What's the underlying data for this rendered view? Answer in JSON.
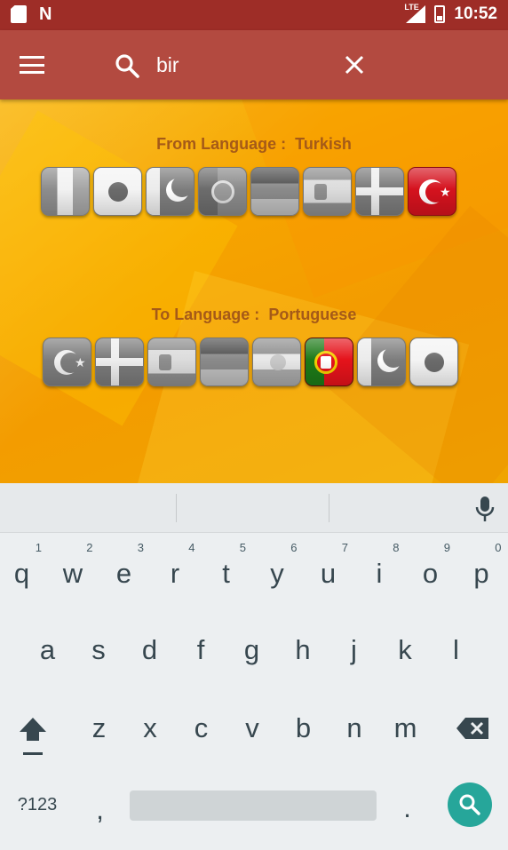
{
  "status_bar": {
    "time": "10:52",
    "network": "LTE"
  },
  "app_bar": {
    "search_query": "bir"
  },
  "from": {
    "label": "From Language :",
    "value": "Turkish",
    "flags": [
      "flag-italy-gray",
      "flag-japan-gray",
      "flag-pakistan-gray",
      "flag-portugal-gray",
      "flag-germany-gray",
      "flag-spain-gray",
      "flag-denmark-gray",
      "flag-turkey"
    ]
  },
  "to": {
    "label": "To Language :",
    "value": "Portuguese",
    "flags": [
      "flag-turkey-gray",
      "flag-denmark-gray",
      "flag-spain-gray",
      "flag-germany-gray",
      "flag-kurdistan-gray",
      "flag-portugal",
      "flag-pakistan-gray",
      "flag-japan-gray"
    ]
  },
  "keyboard": {
    "row1": [
      {
        "k": "q",
        "n": "1"
      },
      {
        "k": "w",
        "n": "2"
      },
      {
        "k": "e",
        "n": "3"
      },
      {
        "k": "r",
        "n": "4"
      },
      {
        "k": "t",
        "n": "5"
      },
      {
        "k": "y",
        "n": "6"
      },
      {
        "k": "u",
        "n": "7"
      },
      {
        "k": "i",
        "n": "8"
      },
      {
        "k": "o",
        "n": "9"
      },
      {
        "k": "p",
        "n": "0"
      }
    ],
    "row2": [
      "a",
      "s",
      "d",
      "f",
      "g",
      "h",
      "j",
      "k",
      "l"
    ],
    "row3": [
      "z",
      "x",
      "c",
      "v",
      "b",
      "n",
      "m"
    ],
    "symbols_label": "?123",
    "comma": ",",
    "period": "."
  }
}
